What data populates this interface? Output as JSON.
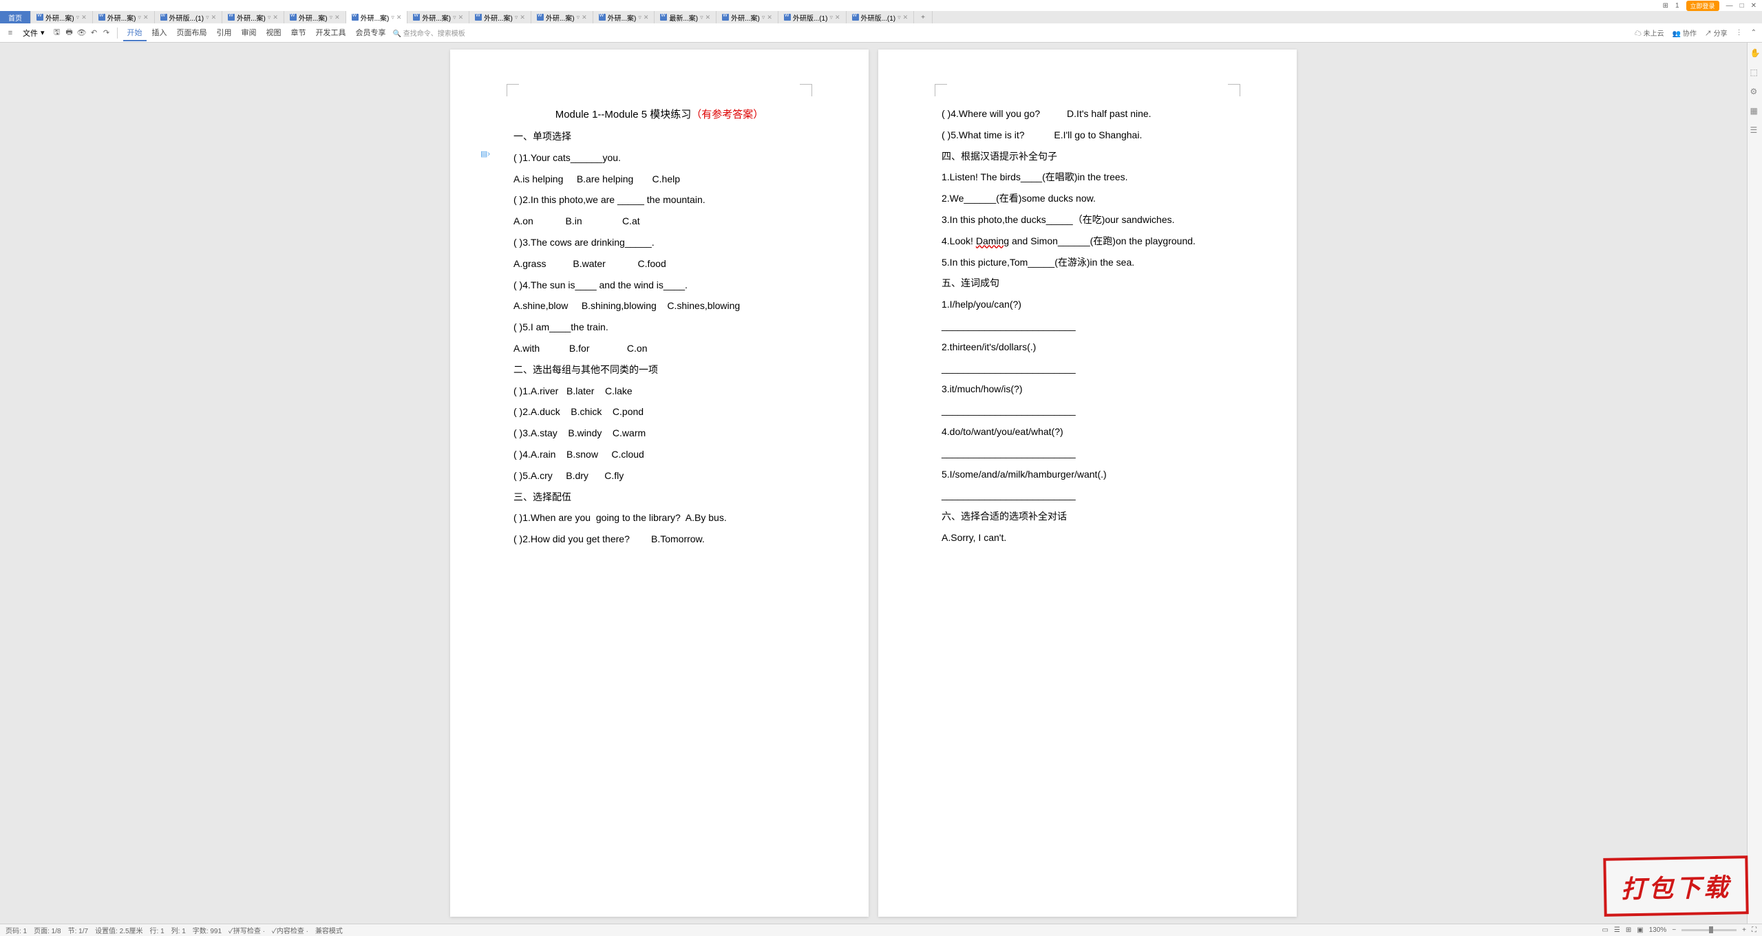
{
  "titlebar": {
    "grid_icon": "⊞",
    "num": "1",
    "login": "立即登录",
    "user": "👤"
  },
  "tabs": {
    "home": "首页",
    "items": [
      {
        "label": "外研...案)"
      },
      {
        "label": "外研...案)"
      },
      {
        "label": "外研版...(1)"
      },
      {
        "label": "外研...案)"
      },
      {
        "label": "外研...案)"
      },
      {
        "label": "外研...案)",
        "active": true
      },
      {
        "label": "外研...案)"
      },
      {
        "label": "外研...案)"
      },
      {
        "label": "外研...案)"
      },
      {
        "label": "外研...案)"
      },
      {
        "label": "最新...案)"
      },
      {
        "label": "外研...案)"
      },
      {
        "label": "外研版...(1)"
      },
      {
        "label": "外研版...(1)"
      }
    ]
  },
  "toolbar": {
    "file": "文件",
    "menus": [
      "开始",
      "插入",
      "页面布局",
      "引用",
      "审阅",
      "视图",
      "章节",
      "开发工具",
      "会员专享"
    ],
    "search_cmd": "查找命令、搜索模板",
    "right": {
      "cloud": "未上云",
      "collab": "协作",
      "share": "分享"
    }
  },
  "doc": {
    "title_main": "Module 1--Module 5 模块练习",
    "title_red": "（有参考答案）",
    "page1": [
      "一、单项选择",
      "( )1.Your cats______you.",
      "A.is helping     B.are helping       C.help",
      "( )2.In this photo,we are _____ the mountain.",
      "A.on            B.in               C.at",
      "( )3.The cows are drinking_____.",
      "A.grass          B.water            C.food",
      "( )4.The sun is____ and the wind is____.",
      "A.shine,blow     B.shining,blowing    C.shines,blowing",
      "( )5.I am____the train.",
      "A.with           B.for              C.on",
      "二、选出每组与其他不同类的一项",
      "( )1.A.river   B.later    C.lake",
      "( )2.A.duck    B.chick    C.pond",
      "( )3.A.stay    B.windy    C.warm",
      "( )4.A.rain    B.snow     C.cloud",
      "( )5.A.cry     B.dry      C.fly",
      "三、选择配伍",
      "( )1.When are you  going to the library?  A.By bus.",
      "( )2.How did you get there?        B.Tomorrow."
    ],
    "page2": [
      "( )4.Where will you go?          D.It's half past nine.",
      "( )5.What time is it?           E.I'll go to Shanghai.",
      "四、根据汉语提示补全句子",
      "1.Listen! The birds____(在唱歌)in the trees.",
      "2.We______(在看)some ducks now.",
      "3.In this photo,the ducks_____（在吃)our sandwiches.",
      "4.Look! Daming and Simon______(在跑)on the playground.",
      "5.In this picture,Tom_____(在游泳)in the sea.",
      "五、连词成句",
      "1.I/help/you/can(?)",
      "_________________________",
      "2.thirteen/it's/dollars(.)",
      "_________________________",
      "3.it/much/how/is(?)",
      "_________________________",
      "4.do/to/want/you/eat/what(?)",
      "_________________________",
      "5.I/some/and/a/milk/hamburger/want(.)",
      "_________________________",
      "六、选择合适的选项补全对话",
      "A.Sorry, I can't."
    ]
  },
  "status": {
    "page": "页码: 1",
    "pages": "页面: 1/8",
    "section": "节: 1/7",
    "setval": "设置值: 2.5厘米",
    "line": "行: 1",
    "col": "列: 1",
    "words": "字数: 991",
    "spell": "拼写检查 ·",
    "content": "内容检查 ·",
    "compat": "兼容模式",
    "zoom": "130%"
  },
  "stamp": "打包下载"
}
